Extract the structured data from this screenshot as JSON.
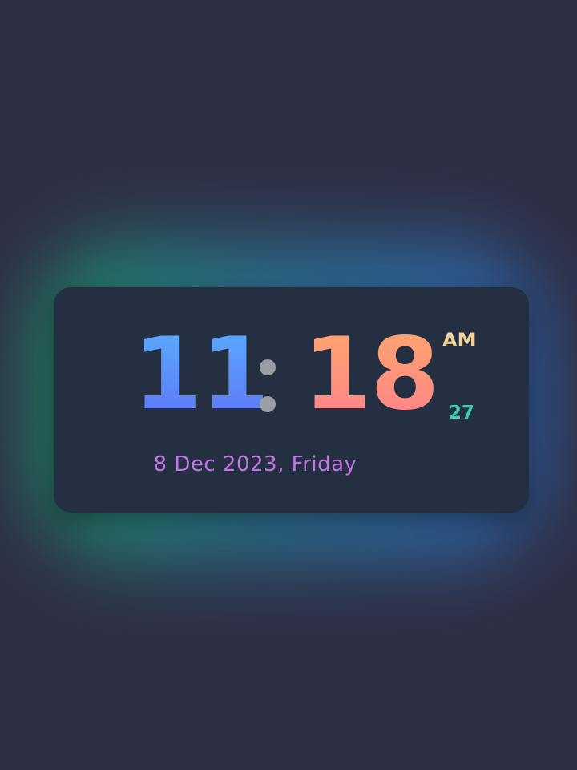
{
  "clock": {
    "hours": "11",
    "minutes": "18",
    "ampm": "AM",
    "seconds": "27",
    "date": "8 Dec 2023, Friday"
  },
  "colors": {
    "background": "#2e2f45",
    "card": "#252f42",
    "hours_gradient": [
      "#5ab2ff",
      "#5f6ff5"
    ],
    "minutes_gradient": [
      "#ffa96a",
      "#ff7f8e"
    ],
    "colon": "#9b9ea5",
    "ampm": "#f1d39b",
    "seconds": "#33d1b5",
    "date": "#c176e3",
    "glow": [
      "#1f8a62",
      "#2f5fa8"
    ]
  }
}
